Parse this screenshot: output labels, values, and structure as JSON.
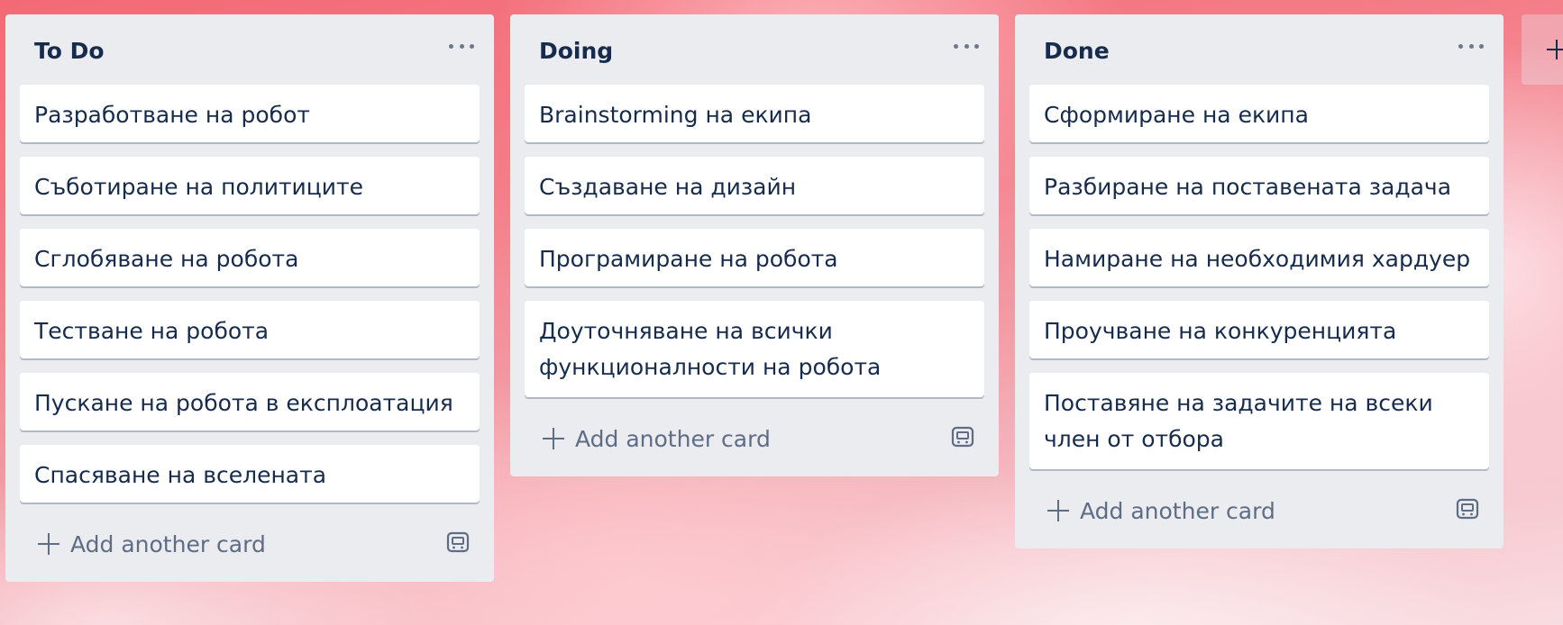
{
  "board": {
    "lists": [
      {
        "title": "To Do",
        "cards": [
          "Разработване на робот",
          "Съботиране на политиците",
          "Сглобяване на робота",
          "Тестване на робота",
          "Пускане на робота в експлоатация",
          "Спасяване на вселената"
        ],
        "add_card_label": "Add another card"
      },
      {
        "title": "Doing",
        "cards": [
          "Brainstorming на екипа",
          "Създаване на дизайн",
          "Програмиране на робота",
          "Доуточняване на всички функционалности на робота"
        ],
        "add_card_label": "Add another card"
      },
      {
        "title": "Done",
        "cards": [
          "Сформиране на екипа",
          "Разбиране на поставената задача",
          "Намиране на необходимия хардуер",
          "Проучване на конкуренцията",
          "Поставяне на задачите на всеки член от отбора"
        ],
        "add_card_label": "Add another card"
      }
    ],
    "icons": {
      "list_menu": "more-horizontal-icon",
      "add_card": "plus-icon",
      "template": "card-template-icon",
      "add_list": "plus-icon"
    }
  },
  "colors": {
    "list_bg": "#ebecf0",
    "card_bg": "#ffffff",
    "text": "#172b4d",
    "muted": "#5e6c84"
  }
}
